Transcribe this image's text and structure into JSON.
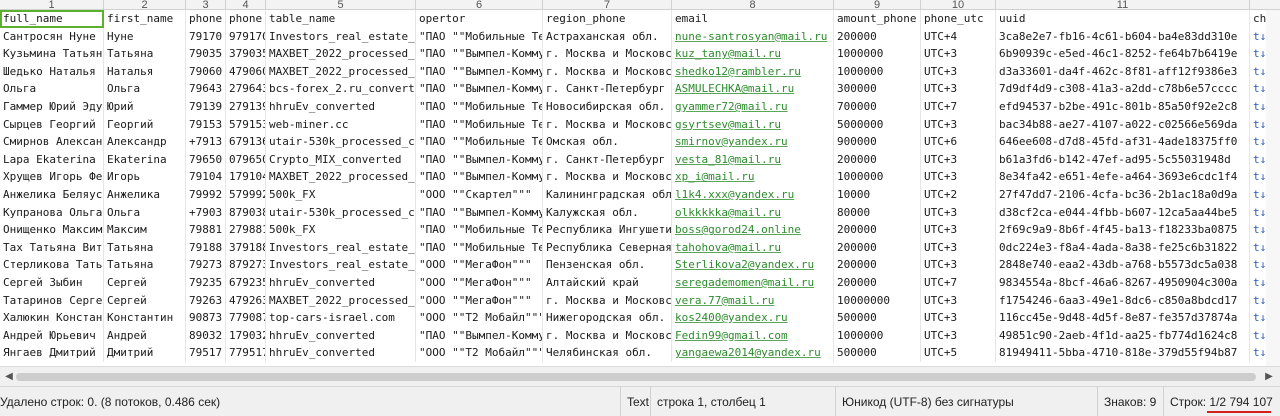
{
  "column_numbers": [
    "1",
    "2",
    "3",
    "4",
    "5",
    "6",
    "7",
    "8",
    "9",
    "10",
    "11"
  ],
  "columns": [
    "full_name",
    "first_name",
    "phone",
    "phone",
    "table_name",
    "opertor",
    "region_phone",
    "email",
    "amount_phone",
    "phone_utc",
    "uuid",
    "chec"
  ],
  "rows": [
    [
      "Сантросян Нуне",
      "Нуне",
      "79170",
      "9791709",
      "Investors_real_estate_",
      "\"ПАО \"\"Мобильные Те",
      "Астраханская обл.",
      "nune-santrosyan@mail.ru",
      "200000",
      "UTC+4",
      "3ca8e2e7-fb16-4c61-b604-ba4e83dd310e",
      "t↓"
    ],
    [
      "Кузьмина Татьян",
      "Татьяна",
      "79035",
      "3790353",
      "MAXBET_2022_processed_",
      "\"ПАО \"\"Вымпел-Комму",
      "г. Москва и Московс",
      "kuz_tany@mail.ru",
      "1000000",
      "UTC+3",
      "6b90939c-e5ed-46c1-8252-fe64b7b6419e",
      "t↓"
    ],
    [
      "Шедько Наталья",
      "Наталья",
      "79060",
      "4790604",
      "MAXBET_2022_processed_",
      "\"ПАО \"\"Вымпел-Комму",
      "г. Москва и Московс",
      "shedko12@rambler.ru",
      "1000000",
      "UTC+3",
      "d3a33601-da4f-462c-8f81-aff12f9386e3",
      "t↓"
    ],
    [
      "Ольга",
      "Ольга",
      "79643",
      "2796432",
      "bcs-forex_2.ru_convert",
      "\"ПАО \"\"Вымпел-Комму",
      "г. Санкт-Петербург",
      "ASMULECHKA@mail.ru",
      "300000",
      "UTC+3",
      "7d9df4d9-c308-41a3-a2dd-c78b6e57cccc",
      "t↓"
    ],
    [
      "Гаммер Юрий Эду",
      "Юрий",
      "79139",
      "2791392",
      "hhruEv_converted",
      "\"ПАО \"\"Мобильные Те",
      "Новосибирская обл.",
      "gyammer72@mail.ru",
      "700000",
      "UTC+7",
      "efd94537-b2be-491c-801b-85a50f92e2c8",
      "t↓"
    ],
    [
      "Сырцев Георгий",
      "Георгий",
      "79153",
      "5791535",
      "web-miner.cc",
      "\"ПАО \"\"Мобильные Те",
      "г. Москва и Московс",
      "gsyrtsev@mail.ru",
      "5000000",
      "UTC+3",
      "bac34b88-ae27-4107-a022-c02566e569da",
      "t↓"
    ],
    [
      "Смирнов Алексан",
      "Александр",
      "+7913",
      "6791363",
      "utair-530k_processed_c",
      "\"ПАО \"\"Мобильные Те",
      "Омская обл.",
      "smirnov@yandex.ru",
      "900000",
      "UTC+6",
      "646ee608-d7d8-45fd-af31-4ade18375ff0",
      "t↓"
    ],
    [
      "Lapa Ekaterina",
      "Ekaterina",
      "79650",
      "0796500",
      "Crypto_MIX_converted",
      "\"ПАО \"\"Вымпел-Комму",
      "г. Санкт-Петербург",
      "vesta_81@mail.ru",
      "200000",
      "UTC+3",
      "b61a3fd6-b142-47ef-ad95-5c55031948d",
      "t↓"
    ],
    [
      "Хрущев Игорь Фе",
      "Игорь",
      "79104",
      "1791041",
      "MAXBET_2022_processed_",
      "\"ПАО \"\"Вымпел-Комму",
      "г. Москва и Московс",
      "xp_i@mail.ru",
      "1000000",
      "UTC+3",
      "8e34fa42-e651-4efe-a464-3693e6cdc1f4",
      "t↓"
    ],
    [
      "Анжелика Беляус",
      "Анжелика",
      "79992",
      "5799925",
      "500k_FX",
      "\"ООО \"\"Скартел\"\"\"",
      "Калининградская обл.",
      "l1k4.xxx@yandex.ru",
      "10000",
      "UTC+2",
      "27f47dd7-2106-4cfa-bc36-2b1ac18a0d9a",
      "t↓"
    ],
    [
      "Купранова Ольга",
      "Ольга",
      "+7903",
      "8790381",
      "utair-530k_processed_c",
      "\"ПАО \"\"Вымпел-Комму",
      "Калужская обл.",
      "olkkkkka@mail.ru",
      "80000",
      "UTC+3",
      "d38cf2ca-e044-4fbb-b607-12ca5aa44be5",
      "t↓"
    ],
    [
      "Онищенко Максим",
      "Максим",
      "79881",
      "2798812",
      "500k_FX",
      "\"ПАО \"\"Мобильные Те",
      "Республика Ингушети",
      "boss@gorod24.online",
      "200000",
      "UTC+3",
      "2f69c9a9-8b6f-4f45-ba13-f18233ba0875",
      "t↓"
    ],
    [
      "Тах Татьяна Вит",
      "Татьяна",
      "79188",
      "3791883",
      "Investors_real_estate_",
      "\"ПАО \"\"Мобильные Те",
      "Республика Северная",
      "tahohova@mail.ru",
      "200000",
      "UTC+3",
      "0dc224e3-f8a4-4ada-8a38-fe25c6b31822",
      "t↓"
    ],
    [
      "Стерликова Тать",
      "Татьяна",
      "79273",
      "8792738",
      "Investors_real_estate_",
      "\"ООО \"\"МегаФон\"\"\"",
      "Пензенская обл.",
      "Sterlikova2@yandex.ru",
      "200000",
      "UTC+3",
      "2848e740-eaa2-43db-a768-b5573dc5a038",
      "t↓"
    ],
    [
      "Сергей Зыбин",
      "Сергей",
      "79235",
      "6792356",
      "hhruEv_converted",
      "\"ООО \"\"МегаФон\"\"\"",
      "Алтайский край",
      "seregademomen@mail.ru",
      "200000",
      "UTC+7",
      "9834554a-8bcf-46a6-8267-4950904c300a",
      "t↓"
    ],
    [
      "Татаринов Серге",
      "Сергей",
      "79263",
      "4792634",
      "MAXBET_2022_processed_",
      "\"ООО \"\"МегаФон\"\"\"",
      "г. Москва и Московс",
      "vera.77@mail.ru",
      "10000000",
      "UTC+3",
      "f1754246-6aa3-49e1-8dc6-c850a8bdcd17",
      "t↓"
    ],
    [
      "Халюкин Констан",
      "Константин",
      "90873",
      "7790873",
      "top-cars-israel.com",
      "\"ООО \"\"Т2 Мобайл\"\"\"",
      "Нижегородская обл.",
      "kos2400@yandex.ru",
      "500000",
      "UTC+3",
      "116cc45e-9d48-4d5f-8e87-fe357d37874a",
      "t↓"
    ],
    [
      "Андрей Юрьевич",
      "Андрей",
      "89032",
      "1790321",
      "hhruEv_converted",
      "\"ПАО \"\"Вымпел-Комму",
      "г. Москва и Московс",
      "Fedin99@gmail.com",
      "1000000",
      "UTC+3",
      "49851c90-2aeb-4f1d-aa25-fb774d1624c8",
      "t↓"
    ],
    [
      "Янгаев Дмитрий",
      "Дмитрий",
      "79517",
      "7795177",
      "hhruEv_converted",
      "\"ООО \"\"Т2 Мобайл\"\"\"",
      "Челябинская обл.",
      "yangaewa2014@yandex.ru",
      "500000",
      "UTC+5",
      "81949411-5bba-4710-818e-379d55f94b87",
      "t↓"
    ]
  ],
  "statusbar": {
    "left": "Удалено строк: 0. (8 потоков, 0.486 сек)",
    "mode": "Text",
    "position": "строка 1, столбец 1",
    "encoding": "Юникод (UTF-8) без сигнатуры",
    "chars": "Знаков: 9",
    "lines": "Строк: 1/2 794 107"
  },
  "colors": {
    "selected_cell_bg": "#dff3c8",
    "selected_cell_border": "#5cb030",
    "email_text": "#2e8b2e",
    "line_count_underline": "#d61f1f"
  }
}
